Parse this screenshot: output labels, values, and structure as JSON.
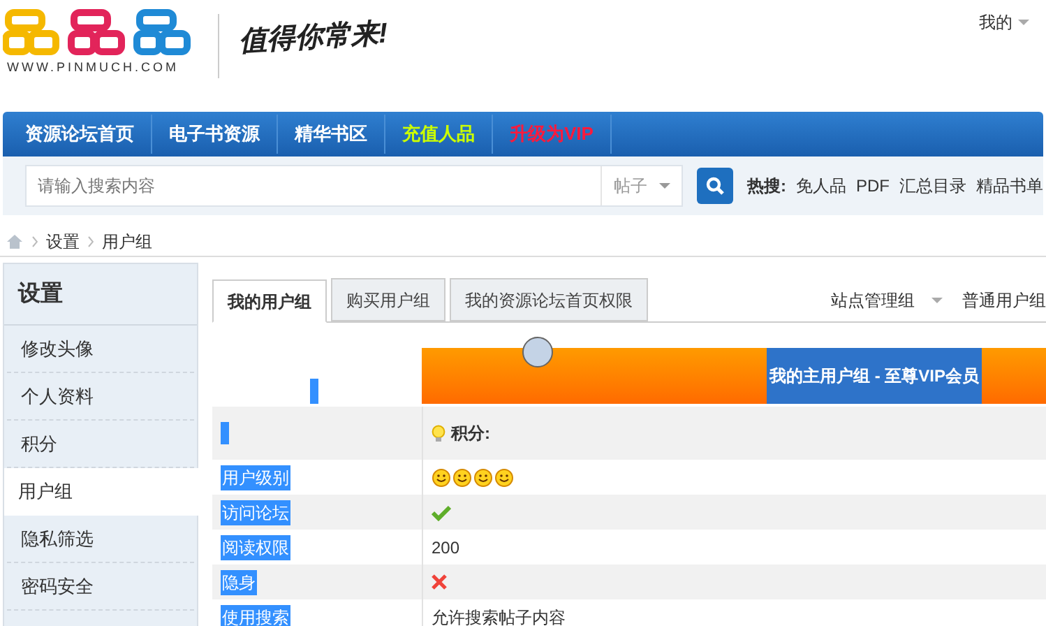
{
  "header": {
    "domain": "WWW.PINMUCH.COM",
    "slogan": "值得你常来!",
    "user_menu": "我的"
  },
  "nav": [
    {
      "label": "资源论坛首页",
      "color": "#ffffff"
    },
    {
      "label": "电子书资源",
      "color": "#ffffff"
    },
    {
      "label": "精华书区",
      "color": "#ffffff"
    },
    {
      "label": "充值人品",
      "color": "#ccff00"
    },
    {
      "label": "升级为VIP",
      "color": "#ff1a3c"
    }
  ],
  "search": {
    "placeholder": "请输入搜索内容",
    "scope": "帖子",
    "hot_label": "热搜:",
    "hot": [
      "免人品",
      "PDF",
      "汇总目录",
      "精品书单"
    ]
  },
  "breadcrumb": [
    "设置",
    "用户组"
  ],
  "sidebar": {
    "title": "设置",
    "items": [
      {
        "label": "修改头像",
        "selected": false
      },
      {
        "label": "个人资料",
        "selected": false
      },
      {
        "label": "积分",
        "selected": false
      },
      {
        "label": "用户组",
        "selected": true
      },
      {
        "label": "隐私筛选",
        "selected": false
      },
      {
        "label": "密码安全",
        "selected": false
      }
    ]
  },
  "tabs": [
    {
      "label": "我的用户组",
      "selected": true
    },
    {
      "label": "购买用户组",
      "selected": false
    },
    {
      "label": "我的资源论坛首页权限",
      "selected": false
    }
  ],
  "group_menus": [
    "站点管理组",
    "普通用户组"
  ],
  "main_group": "我的主用户组 - 至尊VIP会员",
  "points_label": "积分:",
  "rows": [
    {
      "label": "用户级别",
      "kind": "stars",
      "stars": 4
    },
    {
      "label": "访问论坛",
      "kind": "check"
    },
    {
      "label": "阅读权限",
      "kind": "text",
      "value": "200"
    },
    {
      "label": "隐身",
      "kind": "cross"
    },
    {
      "label": "使用搜索",
      "kind": "text",
      "value": "允许搜索帖子内容"
    }
  ]
}
